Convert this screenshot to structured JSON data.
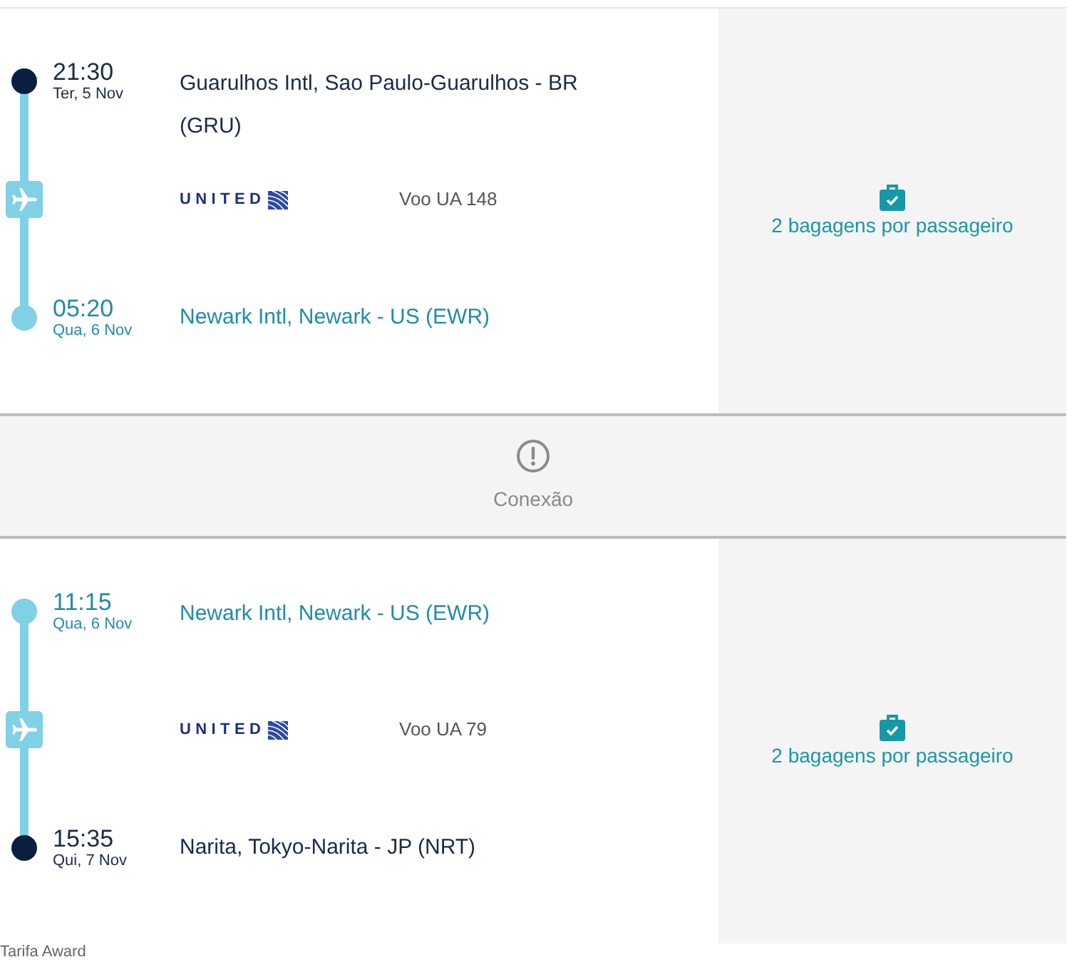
{
  "itinerary": [
    {
      "kind": "segment",
      "departure": {
        "time": "21:30",
        "date": "Ter, 5 Nov",
        "airport": "Guarulhos Intl, Sao Paulo-Guarulhos - BR (GRU)",
        "connection": false
      },
      "airline": "UNITED",
      "flight": "Voo UA 148",
      "arrival": {
        "time": "05:20",
        "date": "Qua, 6 Nov",
        "airport": "Newark Intl, Newark - US (EWR)",
        "connection": true
      },
      "baggage": "2 bagagens por passageiro"
    },
    {
      "kind": "layover",
      "label": "Conexão"
    },
    {
      "kind": "segment",
      "departure": {
        "time": "11:15",
        "date": "Qua, 6 Nov",
        "airport": "Newark Intl, Newark - US (EWR)",
        "connection": true
      },
      "airline": "UNITED",
      "flight": "Voo UA 79",
      "arrival": {
        "time": "15:35",
        "date": "Qui, 7 Nov",
        "airport": "Narita, Tokyo-Narita - JP (NRT)",
        "connection": false
      },
      "baggage": "2 bagagens por passageiro"
    }
  ],
  "fare_type": "Tarifa Award"
}
